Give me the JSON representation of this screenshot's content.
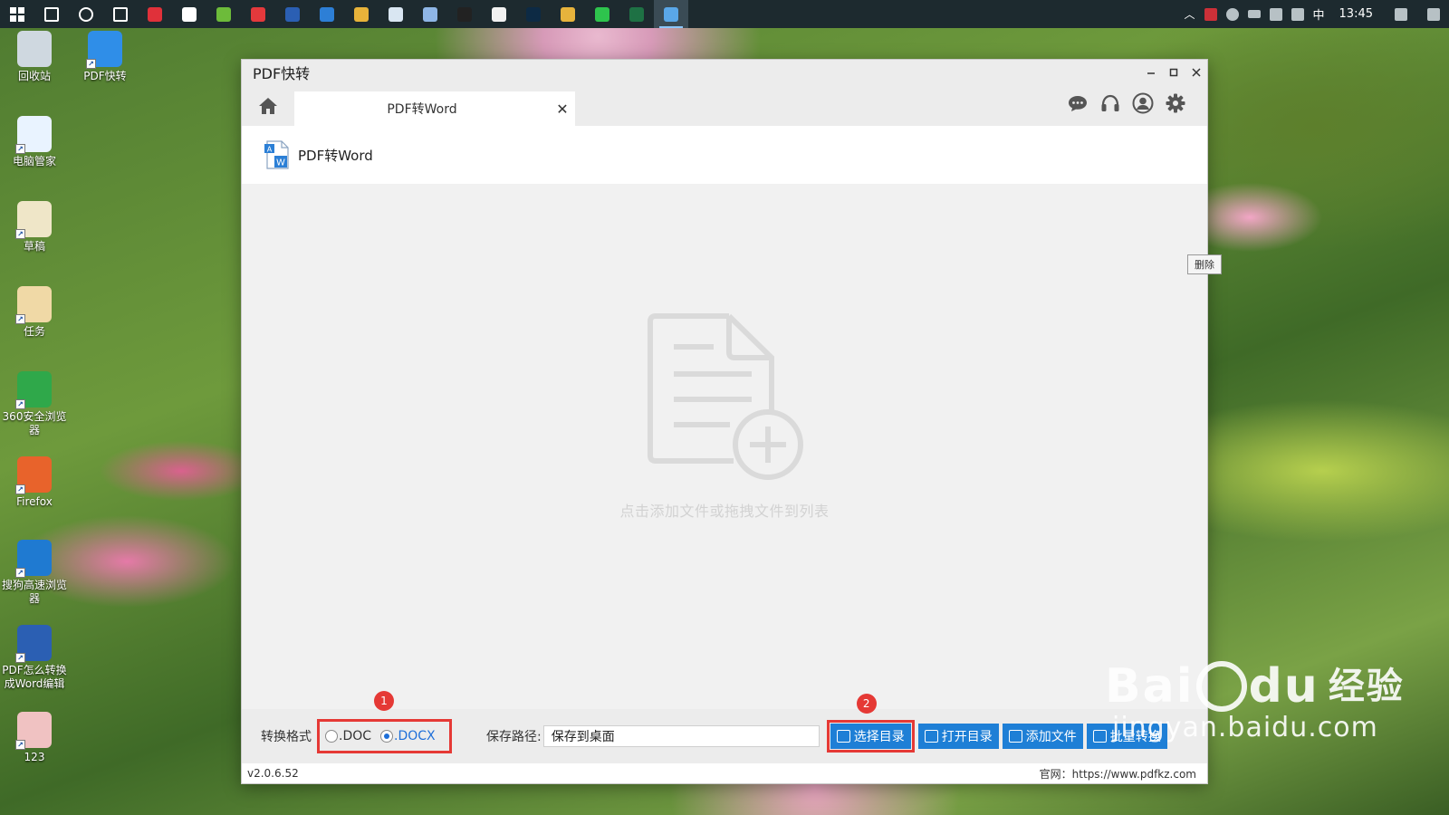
{
  "taskbar": {
    "apps": [
      {
        "name": "search-icon",
        "color": "#ffffff"
      },
      {
        "name": "cortana-icon",
        "color": "#ffffff"
      },
      {
        "name": "task-view-icon",
        "color": "#ffffff"
      },
      {
        "name": "app-red-icon",
        "color": "#e0313a"
      },
      {
        "name": "file-icon",
        "color": "#ffffff"
      },
      {
        "name": "app-green-icon",
        "color": "#6dbb3a"
      },
      {
        "name": "weibo-icon",
        "color": "#e4393c"
      },
      {
        "name": "word-icon",
        "color": "#2b5fb3"
      },
      {
        "name": "edge-icon",
        "color": "#2d7fd6"
      },
      {
        "name": "chrome-icon",
        "color": "#e8b33a"
      },
      {
        "name": "app-blue-icon",
        "color": "#d9e6f2"
      },
      {
        "name": "app-feather-icon",
        "color": "#8fb6e6"
      },
      {
        "name": "qq-icon",
        "color": "#222222"
      },
      {
        "name": "app-orange-icon",
        "color": "#f2f2f2"
      },
      {
        "name": "photoshop-icon",
        "color": "#0d2a44"
      },
      {
        "name": "app-yellow-icon",
        "color": "#e7b33c"
      },
      {
        "name": "wechat-icon",
        "color": "#2ec44d"
      },
      {
        "name": "excel-icon",
        "color": "#1e7144"
      },
      {
        "name": "pdfkuaizhuan-icon",
        "color": "#5aa7e8"
      }
    ],
    "tray": {
      "ime": "中",
      "time": "13:45"
    }
  },
  "desktop": {
    "icons": [
      {
        "label": "回收站",
        "color": "#cfd8e0"
      },
      {
        "label": "PDF快转",
        "color": "#2f8ee8"
      },
      {
        "label": "电脑管家",
        "color": "#e9f3ff"
      },
      {
        "label": "草稿",
        "color": "#efe6c8"
      },
      {
        "label": "任务",
        "color": "#f0d9a6"
      },
      {
        "label": "360安全浏览器",
        "color": "#2fa84a"
      },
      {
        "label": "Firefox",
        "color": "#e8632b"
      },
      {
        "label": "搜狗高速浏览器",
        "color": "#1f7ad1"
      },
      {
        "label": "PDF怎么转换成Word编辑",
        "color": "#2b5fb3"
      },
      {
        "label": "123",
        "color": "#f0c2c2"
      }
    ]
  },
  "window": {
    "title": "PDF快转",
    "tab_label": "PDF转Word",
    "subheader_title": "PDF转Word",
    "drop_hint": "点击添加文件或拖拽文件到列表",
    "delete_tip": "删除",
    "format_label": "转换格式",
    "format_options": [
      ".DOC",
      ".DOCX"
    ],
    "format_selected": ".DOCX",
    "save_path_label": "保存路径:",
    "save_path_value": "保存到桌面",
    "buttons": {
      "choose_dir": "选择目录",
      "open_dir": "打开目录",
      "add_file": "添加文件",
      "batch_convert": "批量转换"
    },
    "version": "v2.0.6.52",
    "website": "官网：https://www.pdfkz.com"
  },
  "annotations": {
    "badge1": "1",
    "badge2": "2"
  },
  "watermark": {
    "brand": "Bai",
    "brand2": "du",
    "suffix": "经验",
    "url": "jingyan.baidu.com"
  },
  "colors": {
    "accent": "#1e7fd6",
    "highlight": "#e53935"
  }
}
